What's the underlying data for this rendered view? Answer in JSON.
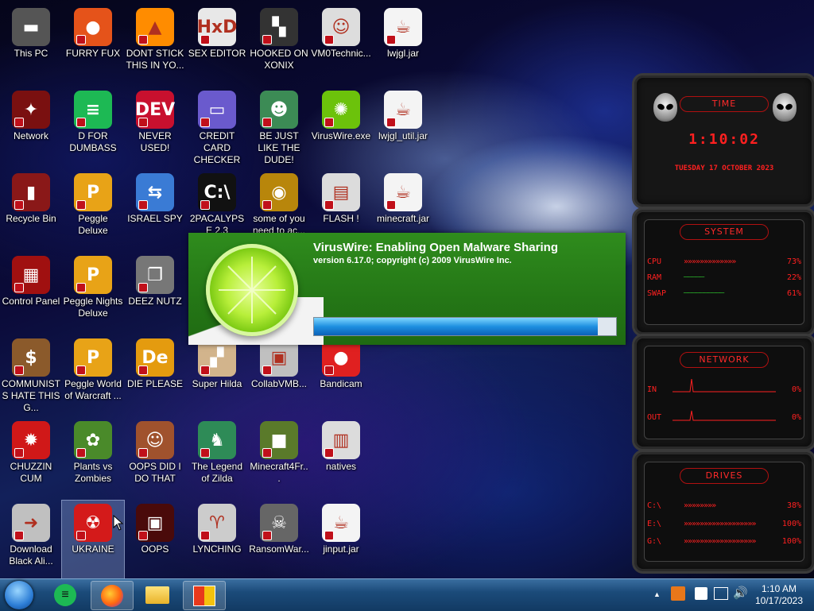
{
  "desktop": {
    "icons": [
      {
        "label": "This PC",
        "glyph": "▬",
        "color": "#555555"
      },
      {
        "label": "FURRY FUX",
        "glyph": "●",
        "color": "#e5531a"
      },
      {
        "label": "DONT STICK THIS IN YO...",
        "glyph": "▲",
        "color": "#ff8c00"
      },
      {
        "label": "SEX EDITOR",
        "glyph": "HxD",
        "color": "#e8e8e8"
      },
      {
        "label": "HOOKED ON XONIX",
        "glyph": "▚",
        "color": "#333333"
      },
      {
        "label": "VM0Technic...",
        "glyph": "☺",
        "color": "#dddddd"
      },
      {
        "label": "lwjgl.jar",
        "glyph": "☕",
        "color": "#f4f4f4"
      },
      {
        "label": "Network",
        "glyph": "✦",
        "color": "#7a1010"
      },
      {
        "label": "D FOR DUMBASS",
        "glyph": "≡",
        "color": "#1db954"
      },
      {
        "label": "NEVER USED!",
        "glyph": "DEV",
        "color": "#c8102e"
      },
      {
        "label": "CREDIT CARD CHECKER",
        "glyph": "▭",
        "color": "#6a5acd"
      },
      {
        "label": "BE JUST LIKE THE DUDE!",
        "glyph": "☻",
        "color": "#3c8b55"
      },
      {
        "label": "VirusWire.exe",
        "glyph": "✺",
        "color": "#6cc20b"
      },
      {
        "label": "lwjgl_util.jar",
        "glyph": "☕",
        "color": "#f4f4f4"
      },
      {
        "label": "Recycle Bin",
        "glyph": "▮",
        "color": "#8a1818"
      },
      {
        "label": "Peggle Deluxe",
        "glyph": "P",
        "color": "#e8a317"
      },
      {
        "label": "ISRAEL SPY",
        "glyph": "⇆",
        "color": "#3a7bd5"
      },
      {
        "label": "2PACALYPSE 2.3",
        "glyph": "C:\\",
        "color": "#111111"
      },
      {
        "label": "some of you need to ac...",
        "glyph": "◉",
        "color": "#b8860b"
      },
      {
        "label": "FLASH !",
        "glyph": "▤",
        "color": "#dcdcdc"
      },
      {
        "label": "minecraft.jar",
        "glyph": "☕",
        "color": "#f4f4f4"
      },
      {
        "label": "Control Panel",
        "glyph": "▦",
        "color": "#a01010"
      },
      {
        "label": "Peggle Nights Deluxe",
        "glyph": "P",
        "color": "#e8a317"
      },
      {
        "label": "DEEZ NUTZ",
        "glyph": "❐",
        "color": "#777777"
      },
      {
        "label": "COMMUNISTS HATE THIS G...",
        "glyph": "$",
        "color": "#8b5a2b"
      },
      {
        "label": "Peggle World of Warcraft ...",
        "glyph": "P",
        "color": "#e8a317"
      },
      {
        "label": "DIE PLEASE",
        "glyph": "De",
        "color": "#e49b0f"
      },
      {
        "label": "Super Hilda",
        "glyph": "▞",
        "color": "#d2b48c"
      },
      {
        "label": "CollabVMB...",
        "glyph": "▣",
        "color": "#c0c0c0"
      },
      {
        "label": "Bandicam",
        "glyph": "●",
        "color": "#e02020"
      },
      {
        "label": "CHUZZIN CUM",
        "glyph": "✹",
        "color": "#d01818"
      },
      {
        "label": "Plants vs Zombies",
        "glyph": "✿",
        "color": "#4a8a2a"
      },
      {
        "label": "OOPS DID I DO THAT",
        "glyph": "☺",
        "color": "#a0522d"
      },
      {
        "label": "The Legend of Zilda",
        "glyph": "♞",
        "color": "#2e8b57"
      },
      {
        "label": "Minecraft4Fr...",
        "glyph": "■",
        "color": "#5a7a2a"
      },
      {
        "label": "natives",
        "glyph": "▥",
        "color": "#dcdcdc"
      },
      {
        "label": "Download Black Ali...",
        "glyph": "➜",
        "color": "#c0c0c0"
      },
      {
        "label": "UKRAINE",
        "glyph": "☢",
        "color": "#d41a1a"
      },
      {
        "label": "OOPS",
        "glyph": "▣",
        "color": "#4a0a0a"
      },
      {
        "label": "LYNCHING",
        "glyph": "♈",
        "color": "#cccccc"
      },
      {
        "label": "RansomWar...",
        "glyph": "☠",
        "color": "#666666"
      },
      {
        "label": "jinput.jar",
        "glyph": "☕",
        "color": "#f4f4f4"
      }
    ]
  },
  "splash": {
    "title": "VirusWire: Enabling Open Malware Sharing",
    "subtitle": "version 6.17.0; copyright (c) 2009 VirusWire Inc.",
    "progress": 0.94
  },
  "gadget": {
    "time": {
      "header": "TIME",
      "clock": "1:10:02",
      "date": "TUESDAY 17 OCTOBER 2023"
    },
    "system": {
      "header": "SYSTEM",
      "rows": [
        {
          "key": "CPU",
          "meter": "»»»»»»»»»»»»»",
          "value": "73%"
        },
        {
          "key": "RAM",
          "meter": "─────",
          "value": "22%"
        },
        {
          "key": "SWAP",
          "meter": "──────────",
          "value": "61%"
        }
      ]
    },
    "network": {
      "header": "NETWORK",
      "rows": [
        {
          "key": "IN",
          "value": "0%"
        },
        {
          "key": "OUT",
          "value": "0%"
        }
      ]
    },
    "drives": {
      "header": "DRIVES",
      "rows": [
        {
          "key": "C:\\",
          "meter": "»»»»»»»»",
          "value": "38%"
        },
        {
          "key": "E:\\",
          "meter": "»»»»»»»»»»»»»»»»»»",
          "value": "100%"
        },
        {
          "key": "G:\\",
          "meter": "»»»»»»»»»»»»»»»»»»",
          "value": "100%"
        }
      ]
    }
  },
  "taskbar": {
    "clock_time": "1:10 AM",
    "clock_date": "10/17/2023",
    "tray_arrow": "▲"
  }
}
